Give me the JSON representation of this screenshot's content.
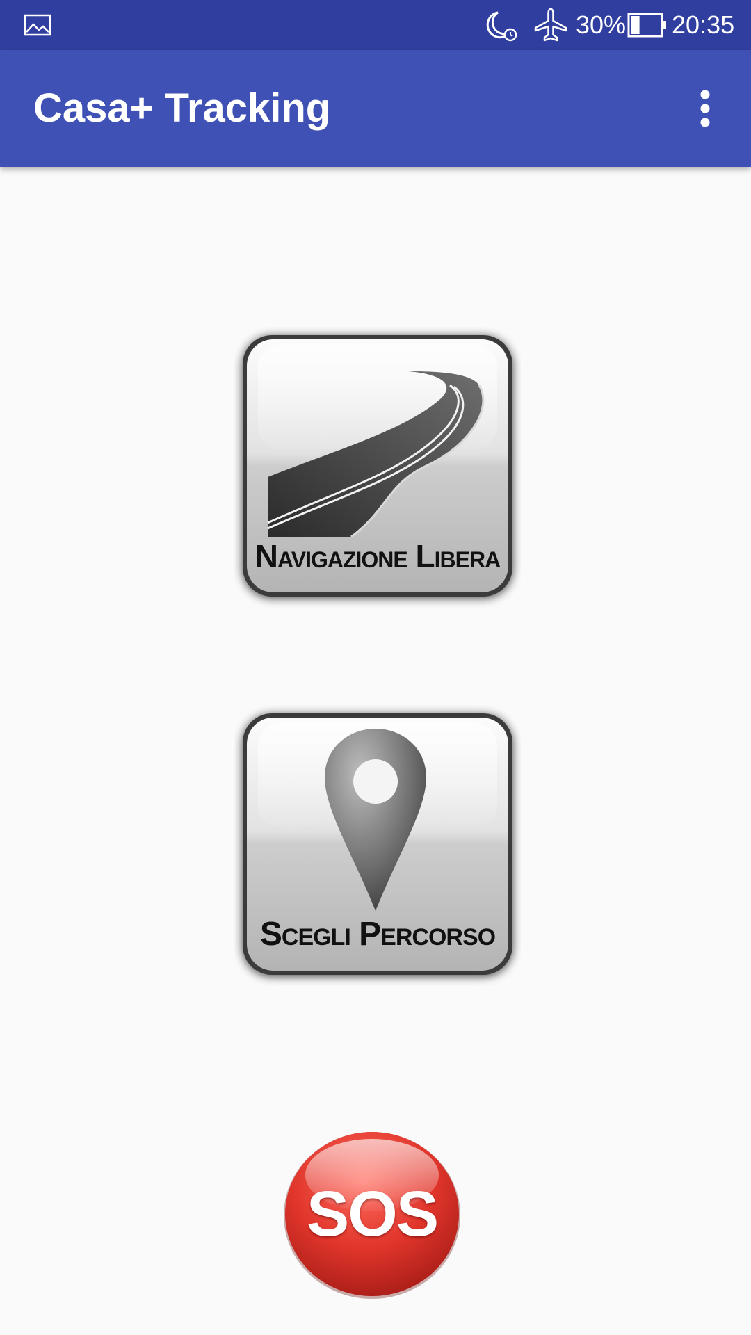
{
  "status_bar": {
    "battery_percent": "30%",
    "battery_level": 0.3,
    "time": "20:35",
    "icons": [
      "gallery-icon",
      "do-not-disturb-alarm-icon",
      "airplane-mode-icon",
      "battery-icon"
    ]
  },
  "app_bar": {
    "title": "Casa+ Tracking",
    "overflow_icon": "more-vert-icon"
  },
  "tiles": [
    {
      "label": "Navigazione Libera",
      "icon": "road-icon"
    },
    {
      "label": "Scegli Percorso",
      "icon": "location-pin-icon"
    }
  ],
  "sos": {
    "label": "SOS"
  },
  "colors": {
    "status_bar": "#303f9f",
    "app_bar": "#3f51b5",
    "background": "#fafafa",
    "sos_red": "#d8312a"
  }
}
